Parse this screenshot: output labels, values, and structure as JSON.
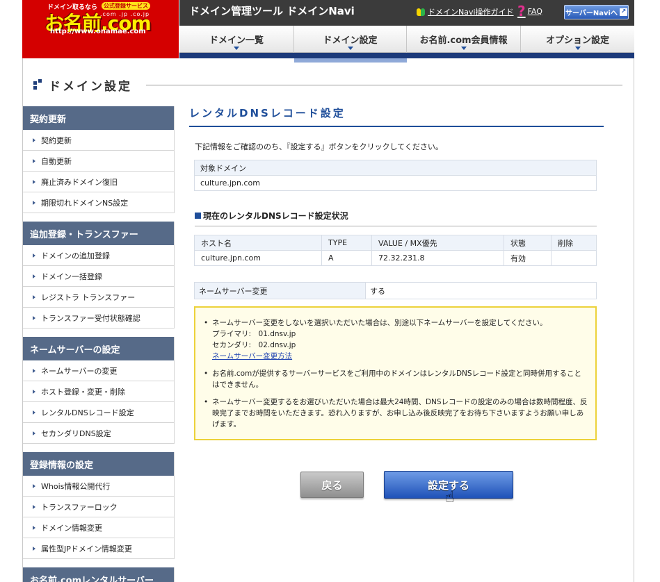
{
  "logo": {
    "tagline": "ドメイン取るなら",
    "badge": "公式登録サービス",
    "tlds": ".com .jp .co.jp",
    "brand": "お名前.com",
    "url": "http://www.onamae.com"
  },
  "header": {
    "tool_title": "ドメイン管理ツール ドメインNavi",
    "guide_link": "ドメインNavi操作ガイド",
    "faq_link": "FAQ",
    "server_button": "サーバーNaviへ"
  },
  "nav": {
    "tabs": [
      {
        "label": "ドメイン一覧",
        "active": false
      },
      {
        "label": "ドメイン設定",
        "active": true
      },
      {
        "label": "お名前.com会員情報",
        "active": false
      },
      {
        "label": "オプション設定",
        "active": false
      }
    ]
  },
  "page": {
    "heading": "ドメイン設定"
  },
  "sidebar": {
    "groups": [
      {
        "title": "契約更新",
        "items": [
          "契約更新",
          "自動更新",
          "廃止済みドメイン復旧",
          "期限切れドメインNS設定"
        ]
      },
      {
        "title": "追加登録・トランスファー",
        "items": [
          "ドメインの追加登録",
          "ドメイン一括登録",
          "レジストラ トランスファー",
          "トランスファー受付状態確認"
        ]
      },
      {
        "title": "ネームサーバーの設定",
        "items": [
          "ネームサーバーの変更",
          "ホスト登録・変更・削除",
          "レンタルDNSレコード設定",
          "セカンダリDNS設定"
        ]
      },
      {
        "title": "登録情報の設定",
        "items": [
          "Whois情報公開代行",
          "トランスファーロック",
          "ドメイン情報変更",
          "属性型JPドメイン情報変更"
        ]
      },
      {
        "title": "お名前.comレンタルサーバー",
        "items": []
      }
    ]
  },
  "main": {
    "section_title": "レンタルDNSレコード設定",
    "intro": "下記情報をご確認ののち、『設定する』ボタンをクリックしてください。",
    "target": {
      "label": "対象ドメイン",
      "value": "culture.jpn.com"
    },
    "status_heading": "現在のレンタルDNSレコード設定状況",
    "records": {
      "headers": [
        "ホスト名",
        "TYPE",
        "VALUE / MX優先",
        "状態",
        "削除"
      ],
      "rows": [
        [
          "culture.jpn.com",
          "A",
          "72.32.231.8",
          "有効",
          ""
        ]
      ]
    },
    "ns_change": {
      "label": "ネームサーバー変更",
      "value": "する"
    },
    "notice": {
      "item1_text": "ネームサーバー変更をしないを選択いただいた場合は、別途以下ネームサーバーを設定してください。",
      "primary": "プライマリ:　01.dnsv.jp",
      "secondary": "セカンダリ:　02.dnsv.jp",
      "link": "ネームサーバー変更方法",
      "item2": "お名前.comが提供するサーバーサービスをご利用中のドメインはレンタルDNSレコード設定と同時併用することはできません。",
      "item3": "ネームサーバー変更するをお選びいただいた場合は最大24時間、DNSレコードの設定のみの場合は数時間程度、反映完了までお時間をいただきます。恐れ入りますが、お申し込み後反映完了をお待ち下さいますようお願い申しあげます。"
    },
    "back_button": "戻る",
    "submit_button": "設定する"
  },
  "colors": {
    "brand_red": "#d40000",
    "accent_blue": "#1f4e9a",
    "sidebar_head": "#566a88",
    "notice_border": "#ecd23a"
  },
  "icons": {
    "guide": "beginner-leaf-icon",
    "faq": "question-icon",
    "server": "arrow-icon",
    "cursor": "hand-cursor-icon"
  }
}
